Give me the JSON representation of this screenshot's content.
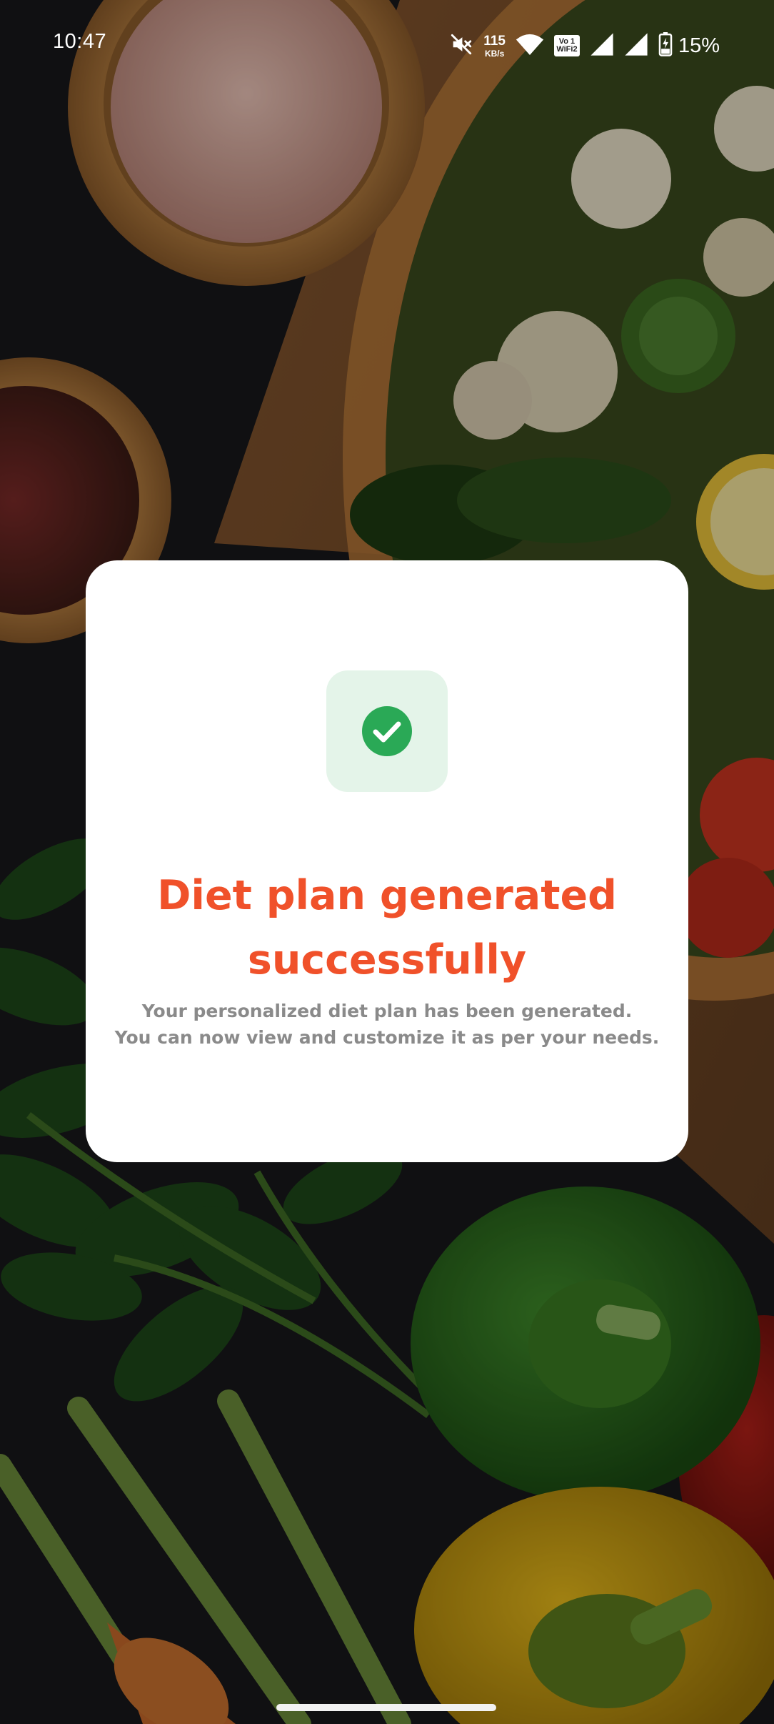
{
  "status_bar": {
    "time": "10:47",
    "net_speed_value": "115",
    "net_speed_unit": "KB/s",
    "volte_line1": "Vo 1",
    "volte_line2": "WiFi2",
    "battery_percent": "15%",
    "icons": [
      "mute-icon",
      "wifi-icon",
      "volte-wifi-icon",
      "signal-icon",
      "signal-icon",
      "battery-charging-icon"
    ]
  },
  "dialog": {
    "icon": "check-circle-icon",
    "title": "Diet plan generated successfully",
    "message_line1": "Your personalized diet plan has been generated.",
    "message_line2": "You can now view and customize it as per your needs."
  },
  "colors": {
    "title": "#f0512a",
    "check": "#2aa956",
    "tile": "#e4f4e9",
    "message": "#8a8a8a"
  }
}
